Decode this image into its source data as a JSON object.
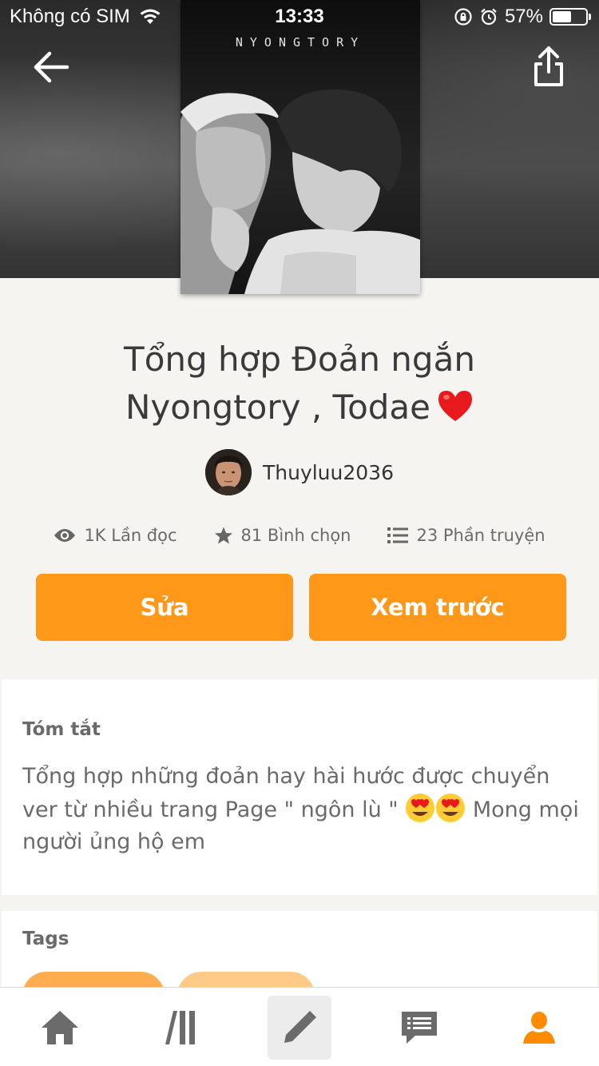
{
  "status_bar": {
    "carrier": "Không có SIM",
    "time": "13:33",
    "battery_percent": "57%",
    "battery_level": 0.57
  },
  "cover": {
    "title": "NYONGTORY"
  },
  "story": {
    "title_line1": "Tổng hợp Đoản ngắn",
    "title_line2": "Nyongtory , Todae",
    "author": "Thuyluu2036"
  },
  "stats": {
    "reads": "1K Lần đọc",
    "votes": "81 Bình chọn",
    "parts": "23 Phần truyện"
  },
  "actions": {
    "edit_label": "Sửa",
    "preview_label": "Xem trước"
  },
  "summary": {
    "label": "Tóm tắt",
    "text_part1": "Tổng hợp những đoản hay hài hước được chuyển ver từ nhiều trang Page \"  ngôn lù \" ",
    "text_part2": " Mong mọi người ủng hộ em"
  },
  "tags": {
    "label": "Tags"
  },
  "colors": {
    "accent": "#ff9818",
    "active_nav": "#ff8c00",
    "muted_text": "#6a6a6a"
  },
  "nav": {
    "items": [
      "home-icon",
      "library-icon",
      "write-icon",
      "messages-icon",
      "profile-icon"
    ],
    "active": "profile-icon"
  }
}
